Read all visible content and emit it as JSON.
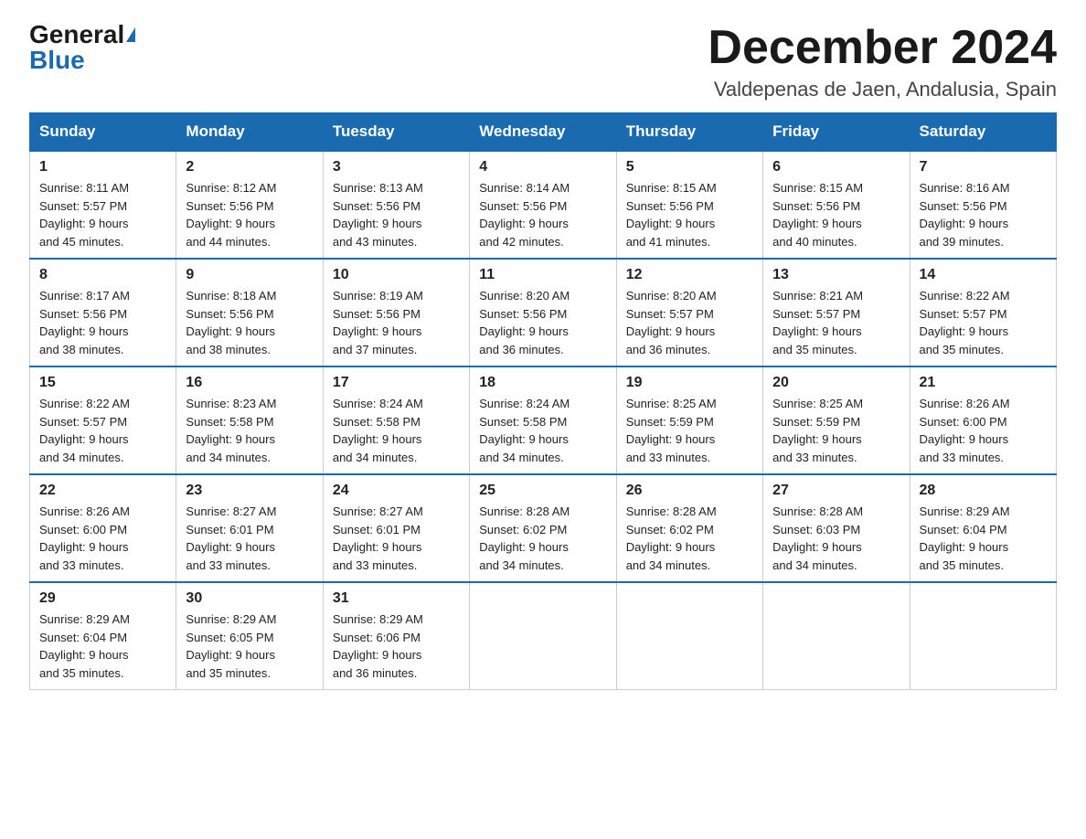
{
  "logo": {
    "general": "General",
    "blue": "Blue"
  },
  "title": "December 2024",
  "location": "Valdepenas de Jaen, Andalusia, Spain",
  "days_of_week": [
    "Sunday",
    "Monday",
    "Tuesday",
    "Wednesday",
    "Thursday",
    "Friday",
    "Saturday"
  ],
  "weeks": [
    [
      {
        "day": "1",
        "sunrise": "8:11 AM",
        "sunset": "5:57 PM",
        "daylight": "9 hours and 45 minutes."
      },
      {
        "day": "2",
        "sunrise": "8:12 AM",
        "sunset": "5:56 PM",
        "daylight": "9 hours and 44 minutes."
      },
      {
        "day": "3",
        "sunrise": "8:13 AM",
        "sunset": "5:56 PM",
        "daylight": "9 hours and 43 minutes."
      },
      {
        "day": "4",
        "sunrise": "8:14 AM",
        "sunset": "5:56 PM",
        "daylight": "9 hours and 42 minutes."
      },
      {
        "day": "5",
        "sunrise": "8:15 AM",
        "sunset": "5:56 PM",
        "daylight": "9 hours and 41 minutes."
      },
      {
        "day": "6",
        "sunrise": "8:15 AM",
        "sunset": "5:56 PM",
        "daylight": "9 hours and 40 minutes."
      },
      {
        "day": "7",
        "sunrise": "8:16 AM",
        "sunset": "5:56 PM",
        "daylight": "9 hours and 39 minutes."
      }
    ],
    [
      {
        "day": "8",
        "sunrise": "8:17 AM",
        "sunset": "5:56 PM",
        "daylight": "9 hours and 38 minutes."
      },
      {
        "day": "9",
        "sunrise": "8:18 AM",
        "sunset": "5:56 PM",
        "daylight": "9 hours and 38 minutes."
      },
      {
        "day": "10",
        "sunrise": "8:19 AM",
        "sunset": "5:56 PM",
        "daylight": "9 hours and 37 minutes."
      },
      {
        "day": "11",
        "sunrise": "8:20 AM",
        "sunset": "5:56 PM",
        "daylight": "9 hours and 36 minutes."
      },
      {
        "day": "12",
        "sunrise": "8:20 AM",
        "sunset": "5:57 PM",
        "daylight": "9 hours and 36 minutes."
      },
      {
        "day": "13",
        "sunrise": "8:21 AM",
        "sunset": "5:57 PM",
        "daylight": "9 hours and 35 minutes."
      },
      {
        "day": "14",
        "sunrise": "8:22 AM",
        "sunset": "5:57 PM",
        "daylight": "9 hours and 35 minutes."
      }
    ],
    [
      {
        "day": "15",
        "sunrise": "8:22 AM",
        "sunset": "5:57 PM",
        "daylight": "9 hours and 34 minutes."
      },
      {
        "day": "16",
        "sunrise": "8:23 AM",
        "sunset": "5:58 PM",
        "daylight": "9 hours and 34 minutes."
      },
      {
        "day": "17",
        "sunrise": "8:24 AM",
        "sunset": "5:58 PM",
        "daylight": "9 hours and 34 minutes."
      },
      {
        "day": "18",
        "sunrise": "8:24 AM",
        "sunset": "5:58 PM",
        "daylight": "9 hours and 34 minutes."
      },
      {
        "day": "19",
        "sunrise": "8:25 AM",
        "sunset": "5:59 PM",
        "daylight": "9 hours and 33 minutes."
      },
      {
        "day": "20",
        "sunrise": "8:25 AM",
        "sunset": "5:59 PM",
        "daylight": "9 hours and 33 minutes."
      },
      {
        "day": "21",
        "sunrise": "8:26 AM",
        "sunset": "6:00 PM",
        "daylight": "9 hours and 33 minutes."
      }
    ],
    [
      {
        "day": "22",
        "sunrise": "8:26 AM",
        "sunset": "6:00 PM",
        "daylight": "9 hours and 33 minutes."
      },
      {
        "day": "23",
        "sunrise": "8:27 AM",
        "sunset": "6:01 PM",
        "daylight": "9 hours and 33 minutes."
      },
      {
        "day": "24",
        "sunrise": "8:27 AM",
        "sunset": "6:01 PM",
        "daylight": "9 hours and 33 minutes."
      },
      {
        "day": "25",
        "sunrise": "8:28 AM",
        "sunset": "6:02 PM",
        "daylight": "9 hours and 34 minutes."
      },
      {
        "day": "26",
        "sunrise": "8:28 AM",
        "sunset": "6:02 PM",
        "daylight": "9 hours and 34 minutes."
      },
      {
        "day": "27",
        "sunrise": "8:28 AM",
        "sunset": "6:03 PM",
        "daylight": "9 hours and 34 minutes."
      },
      {
        "day": "28",
        "sunrise": "8:29 AM",
        "sunset": "6:04 PM",
        "daylight": "9 hours and 35 minutes."
      }
    ],
    [
      {
        "day": "29",
        "sunrise": "8:29 AM",
        "sunset": "6:04 PM",
        "daylight": "9 hours and 35 minutes."
      },
      {
        "day": "30",
        "sunrise": "8:29 AM",
        "sunset": "6:05 PM",
        "daylight": "9 hours and 35 minutes."
      },
      {
        "day": "31",
        "sunrise": "8:29 AM",
        "sunset": "6:06 PM",
        "daylight": "9 hours and 36 minutes."
      },
      null,
      null,
      null,
      null
    ]
  ],
  "labels": {
    "sunrise_prefix": "Sunrise: ",
    "sunset_prefix": "Sunset: ",
    "daylight_prefix": "Daylight: "
  }
}
